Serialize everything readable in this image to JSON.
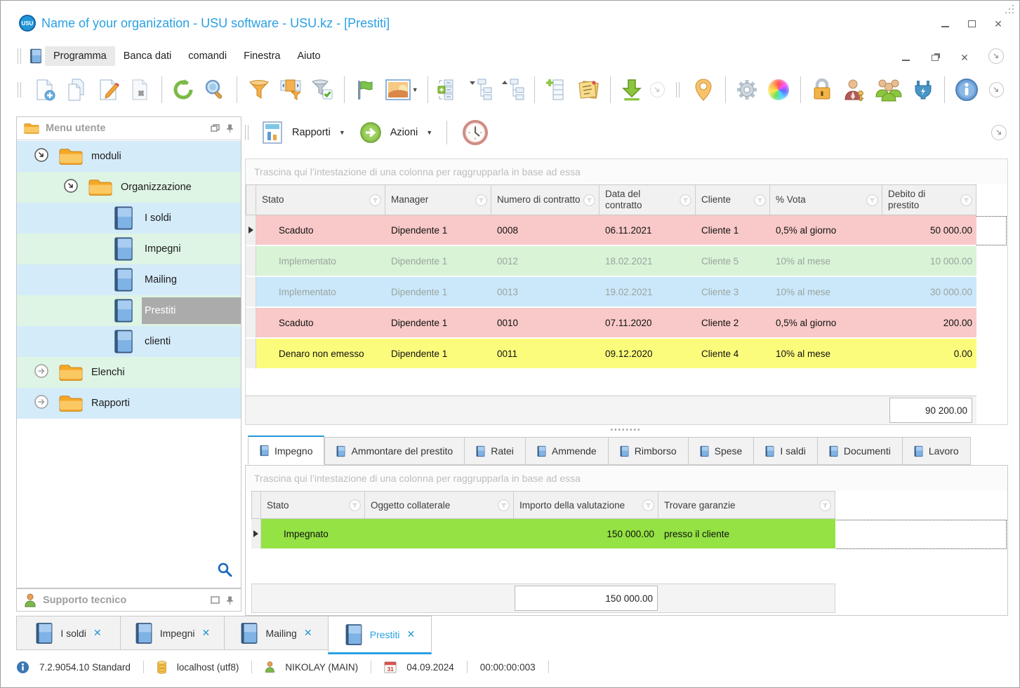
{
  "window": {
    "logo_text": "USU",
    "title": "Name of your organization - USU software - USU.kz - [Prestiti]"
  },
  "menu": {
    "items": [
      "Programma",
      "Banca dati",
      "comandi",
      "Finestra",
      "Aiuto"
    ]
  },
  "toolbar": {
    "icons": [
      "new-record",
      "copy-record",
      "edit-record",
      "delete-record",
      "refresh",
      "search",
      "filter",
      "filter-range",
      "filter-saved",
      "flag",
      "image",
      "expand-rows",
      "collapse-tree",
      "expand-tree",
      "add-column",
      "notes",
      "export",
      "overflow-chevron",
      "map-pin",
      "settings-gear",
      "color-wheel",
      "lock",
      "user-access",
      "users-group",
      "plugin",
      "info",
      "more-chevron"
    ]
  },
  "sidebar": {
    "header": "Menu utente",
    "support": "Supporto tecnico",
    "tree": [
      {
        "label": "moduli"
      },
      {
        "label": "Organizzazione"
      },
      {
        "label": "I soldi"
      },
      {
        "label": "Impegni"
      },
      {
        "label": "Mailing"
      },
      {
        "label": "Prestiti"
      },
      {
        "label": "clienti"
      },
      {
        "label": "Elenchi"
      },
      {
        "label": "Rapporti"
      }
    ]
  },
  "ribbon": {
    "rapporti_label": "Rapporti",
    "azioni_label": "Azioni"
  },
  "grid": {
    "groupby_hint": "Trascina qui l’intestazione di una colonna per raggrupparla in base ad essa",
    "columns": [
      "Stato",
      "Manager",
      "Numero di contratto",
      "Data del contratto",
      "Cliente",
      "% Vota",
      "Debito di prestito"
    ],
    "rows": [
      {
        "cells": [
          "Scaduto",
          "Dipendente 1",
          "0008",
          "06.11.2021",
          "Cliente 1",
          "0,5% al giorno",
          "50 000.00"
        ],
        "color": "pink",
        "selected": true
      },
      {
        "cells": [
          "Implementato",
          "Dipendente 1",
          "0012",
          "18.02.2021",
          "Cliente 5",
          "10% al mese",
          "10 000.00"
        ],
        "color": "green",
        "muted": true
      },
      {
        "cells": [
          "Implementato",
          "Dipendente 1",
          "0013",
          "19.02.2021",
          "Cliente 3",
          "10% al mese",
          "30 000.00"
        ],
        "color": "blue",
        "muted": true
      },
      {
        "cells": [
          "Scaduto",
          "Dipendente 1",
          "0010",
          "07.11.2020",
          "Cliente 2",
          "0,5% al giorno",
          "200.00"
        ],
        "color": "pink"
      },
      {
        "cells": [
          "Denaro non emesso",
          "Dipendente 1",
          "0011",
          "09.12.2020",
          "Cliente 4",
          "10% al mese",
          "0.00"
        ],
        "color": "yellow"
      }
    ],
    "total": "90 200.00"
  },
  "detail": {
    "tabs": [
      "Impegno",
      "Ammontare del prestito",
      "Ratei",
      "Ammende",
      "Rimborso",
      "Spese",
      "I saldi",
      "Documenti",
      "Lavoro"
    ],
    "active_tab": "Impegno",
    "groupby_hint": "Trascina qui l’intestazione di una colonna per raggrupparla in base ad essa",
    "columns": [
      "Stato",
      "Oggetto collaterale",
      "Importo della valutazione",
      "Trovare garanzie"
    ],
    "row": {
      "stato": "Impegnato",
      "oggetto": "",
      "importo": "150 000.00",
      "garanzie": "presso il cliente"
    },
    "total": "150 000.00"
  },
  "bottom_tabs": [
    {
      "label": "I soldi",
      "close": "✕"
    },
    {
      "label": "Impegni",
      "close": "✕"
    },
    {
      "label": "Mailing",
      "close": "✕"
    },
    {
      "label": "Prestiti",
      "close": "✕",
      "active": true
    }
  ],
  "status": {
    "version": "7.2.9054.10 Standard",
    "database": "localhost (utf8)",
    "user": "NIKOLAY (MAIN)",
    "calendar_day": "31",
    "date": "04.09.2024",
    "timer": "00:00:00:003"
  },
  "palette": {
    "accent": "#2196d8",
    "title_blue": "#2aa0e4",
    "row_pink": "#f8c9c8",
    "row_green": "#d9f3d7",
    "row_blue": "#cbe8fb",
    "row_yellow": "#fcfc7c",
    "pledge_green": "#94e244",
    "tree_blue": "#d4ebfa",
    "tree_green": "#def4e4",
    "selection_gray": "#ababab"
  }
}
